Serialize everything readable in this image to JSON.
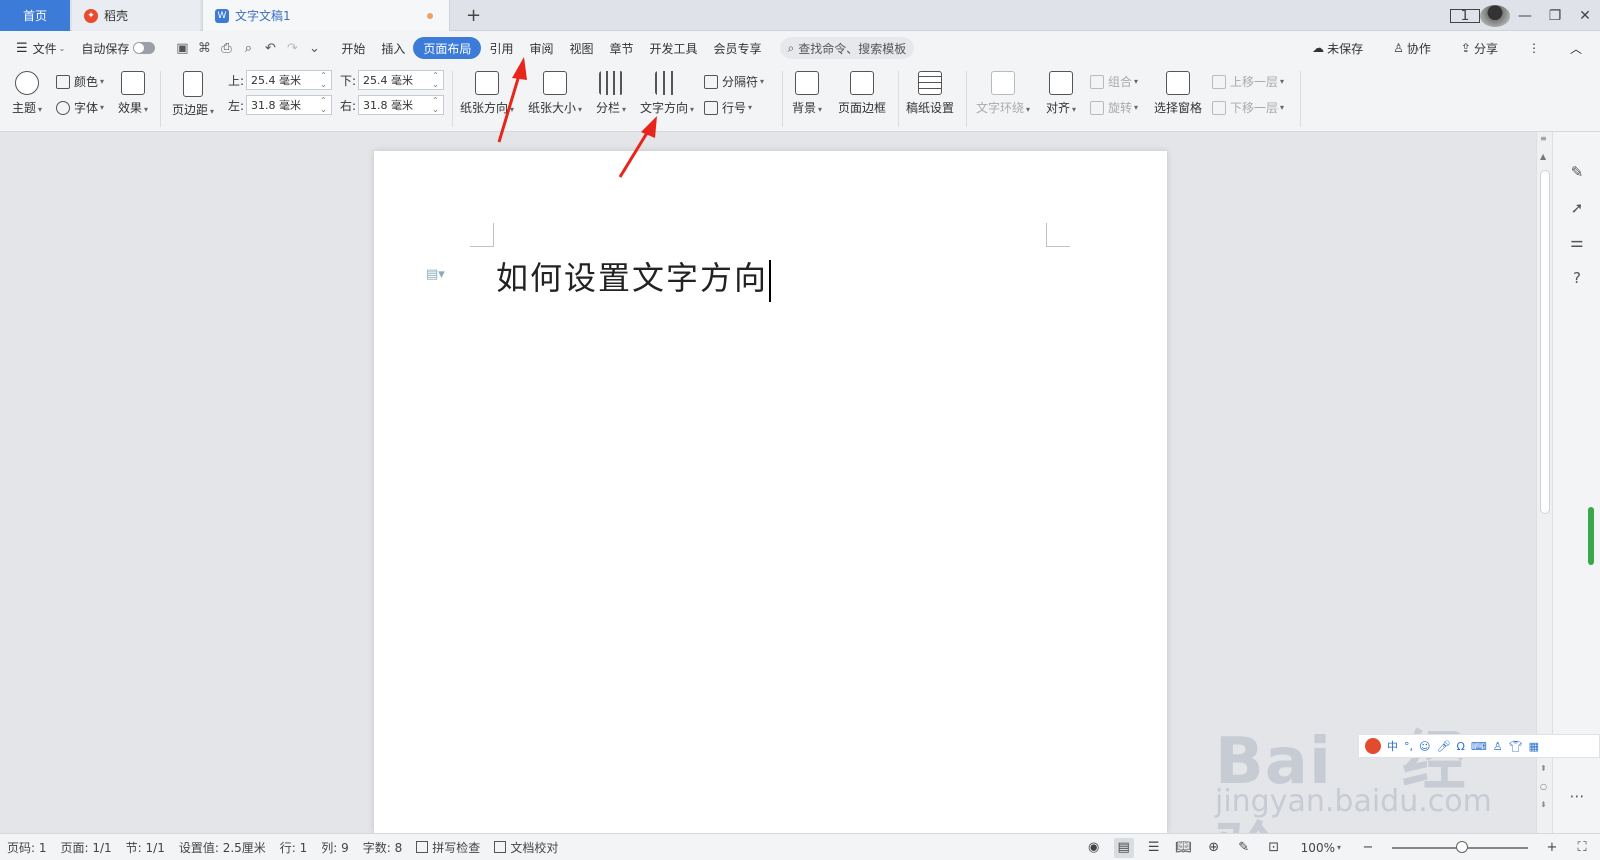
{
  "tabs": {
    "home": "首页",
    "daoke": "稻壳",
    "doc": "文字文稿1",
    "add": "+"
  },
  "window": {
    "page_badge": "1",
    "minimize": "—",
    "restore": "❐",
    "close": "✕"
  },
  "menu": {
    "file": "文件",
    "autosave": "自动保存",
    "items": [
      "开始",
      "插入",
      "页面布局",
      "引用",
      "审阅",
      "视图",
      "章节",
      "开发工具",
      "会员专享"
    ],
    "search_placeholder": "查找命令、搜索模板",
    "unsaved": "未保存",
    "collab": "协作",
    "share": "分享"
  },
  "ribbon": {
    "theme": "主题",
    "color": "颜色",
    "font": "字体",
    "effect": "效果",
    "margins": "页边距",
    "margin_top_label": "上:",
    "margin_top": "25.4 毫米",
    "margin_bottom_label": "下:",
    "margin_bottom": "25.4 毫米",
    "margin_left_label": "左:",
    "margin_left": "31.8 毫米",
    "margin_right_label": "右:",
    "margin_right": "31.8 毫米",
    "orientation": "纸张方向",
    "size": "纸张大小",
    "columns": "分栏",
    "text_direction": "文字方向",
    "breaks": "分隔符",
    "line_numbers": "行号",
    "background": "背景",
    "page_border": "页面边框",
    "paper_setup": "稿纸设置",
    "text_wrap": "文字环绕",
    "align": "对齐",
    "group": "组合",
    "rotate": "旋转",
    "selection_pane": "选择窗格",
    "bring_forward": "上移一层",
    "send_backward": "下移一层"
  },
  "document": {
    "text": "如何设置文字方向"
  },
  "ime": {
    "lang": "中"
  },
  "watermark": {
    "brand": "Bai",
    "brand2": "经验",
    "url": "jingyan.baidu.com"
  },
  "status": {
    "page_num": "页码: 1",
    "pages": "页面: 1/1",
    "section": "节: 1/1",
    "setting": "设置值: 2.5厘米",
    "line": "行: 1",
    "col": "列: 9",
    "words": "字数: 8",
    "spell": "拼写检查",
    "proof": "文档校对",
    "zoom": "100%"
  },
  "colors": {
    "accent": "#3d7bd9",
    "annotation": "#e8251b"
  }
}
